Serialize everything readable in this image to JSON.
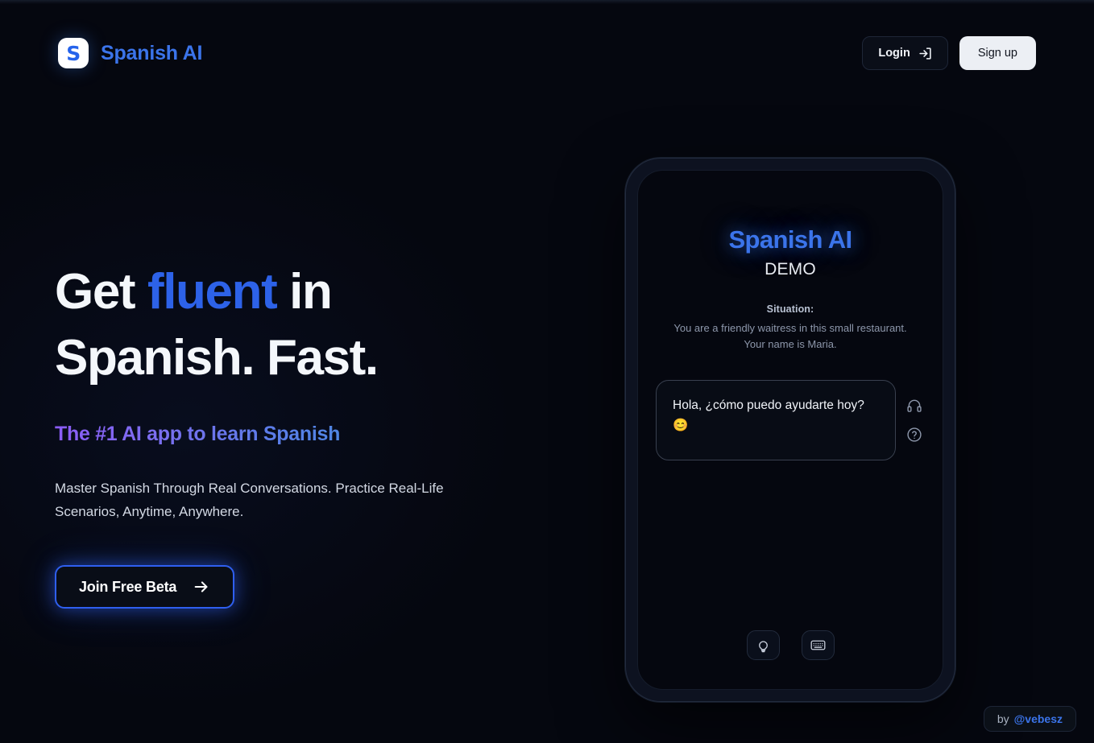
{
  "brand": {
    "mark_letter": "S",
    "name": "Spanish AI"
  },
  "header": {
    "login_label": "Login",
    "signup_label": "Sign up"
  },
  "hero": {
    "title_part1": "Get ",
    "title_accent": "fluent",
    "title_part2": " in",
    "title_line2": "Spanish. Fast.",
    "subtitle": "The #1 AI app to learn Spanish",
    "body": "Master Spanish Through Real Conversations. Practice Real-Life Scenarios, Anytime, Anywhere.",
    "cta_label": "Join Free Beta"
  },
  "phone": {
    "app_title": "Spanish AI",
    "app_mode": "DEMO",
    "situation_label": "Situation:",
    "situation_text": "You are a friendly waitress in this small restaurant. Your name is Maria.",
    "message": "Hola, ¿cómo puedo ayudarte hoy? 😊",
    "tools": [
      {
        "name": "headphones-icon"
      },
      {
        "name": "help-circle-icon"
      }
    ],
    "bottom_actions": [
      {
        "name": "lightbulb-icon"
      },
      {
        "name": "keyboard-icon"
      }
    ]
  },
  "credit": {
    "prefix": "by ",
    "handle": "@vebesz"
  },
  "colors": {
    "background": "#05070f",
    "brand_blue": "#3b74ea",
    "accent_blue": "#2d62e8",
    "cta_border": "#2f5ff0",
    "gradient_start": "#8b5cf6",
    "gradient_end": "#4f86e4",
    "signup_bg": "#eceff4"
  }
}
